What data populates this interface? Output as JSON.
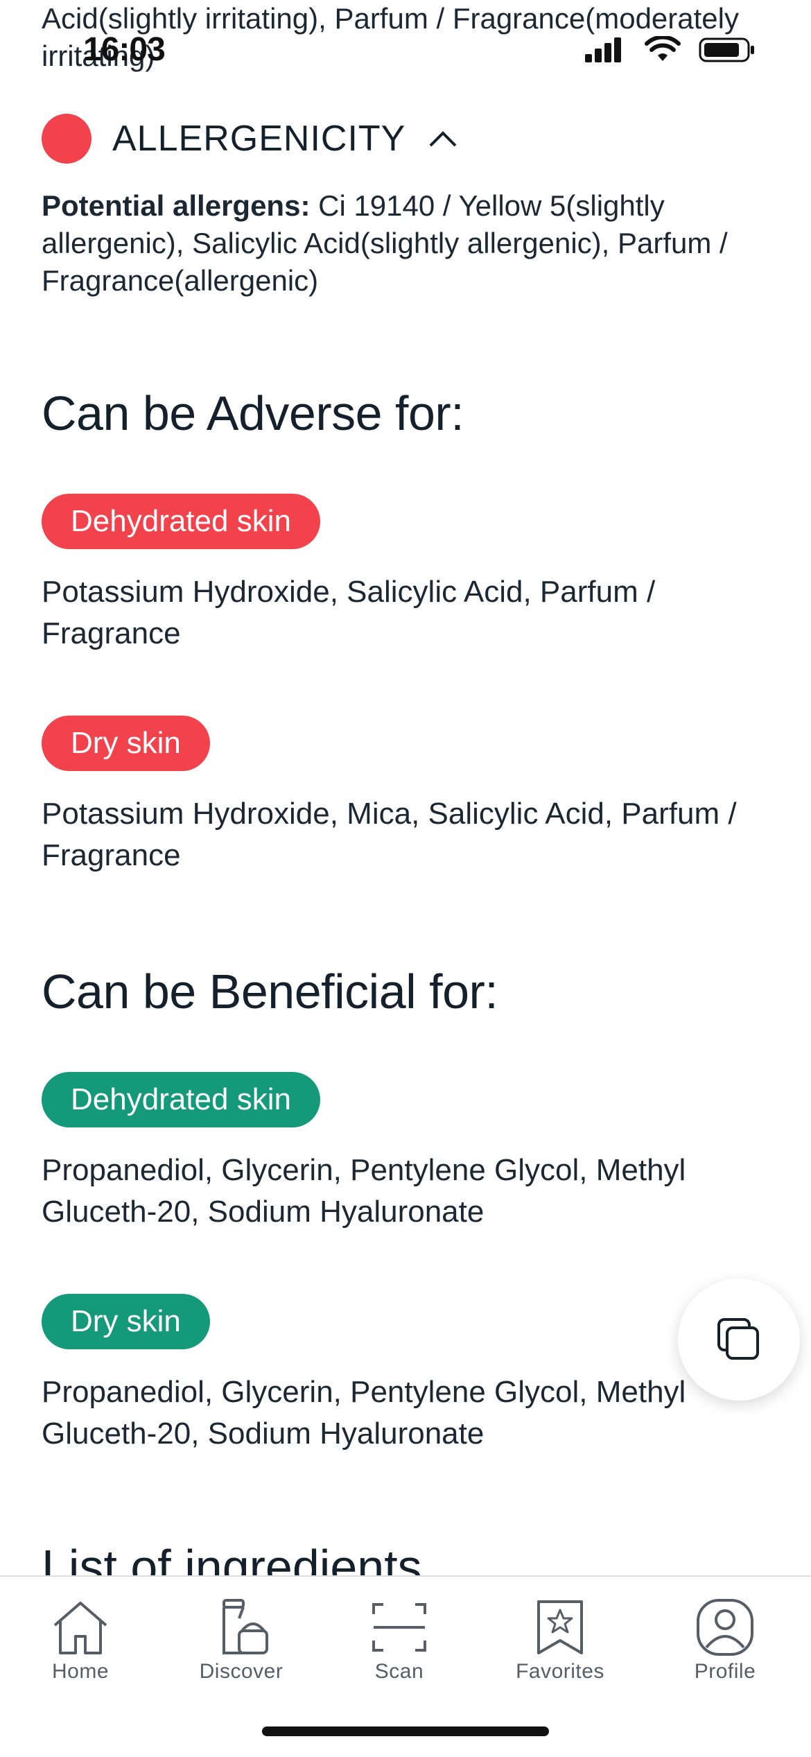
{
  "status_bar": {
    "time": "16:03"
  },
  "top_text": "Acid(slightly irritating), Parfum / Fragrance(moderately irritating)",
  "allergenicity": {
    "title": "ALLERGENICITY",
    "label": "Potential allergens:",
    "text": " Ci 19140 / Yellow 5(slightly allergenic), Salicylic Acid(slightly allergenic), Parfum / Fragrance(allergenic)",
    "dot_color": "#f2434d"
  },
  "adverse": {
    "heading": "Can be Adverse for:",
    "groups": [
      {
        "tag": "Dehydrated skin",
        "ingredients": "Potassium Hydroxide, Salicylic Acid, Parfum / Fragrance"
      },
      {
        "tag": "Dry skin",
        "ingredients": "Potassium Hydroxide, Mica, Salicylic Acid, Parfum / Fragrance"
      }
    ],
    "color": "#f2434d"
  },
  "beneficial": {
    "heading": "Can be Beneficial for:",
    "groups": [
      {
        "tag": "Dehydrated skin",
        "ingredients": "Propanediol, Glycerin, Pentylene Glycol, Methyl Gluceth-20, Sodium Hyaluronate"
      },
      {
        "tag": "Dry skin",
        "ingredients": "Propanediol, Glycerin, Pentylene Glycol, Methyl Gluceth-20, Sodium Hyaluronate"
      }
    ],
    "color": "#14997a"
  },
  "next_heading": "List of ingredients",
  "tabs": [
    {
      "label": "Home",
      "icon": "home-icon"
    },
    {
      "label": "Discover",
      "icon": "discover-icon"
    },
    {
      "label": "Scan",
      "icon": "scan-icon"
    },
    {
      "label": "Favorites",
      "icon": "favorites-icon"
    },
    {
      "label": "Profile",
      "icon": "profile-icon"
    }
  ]
}
